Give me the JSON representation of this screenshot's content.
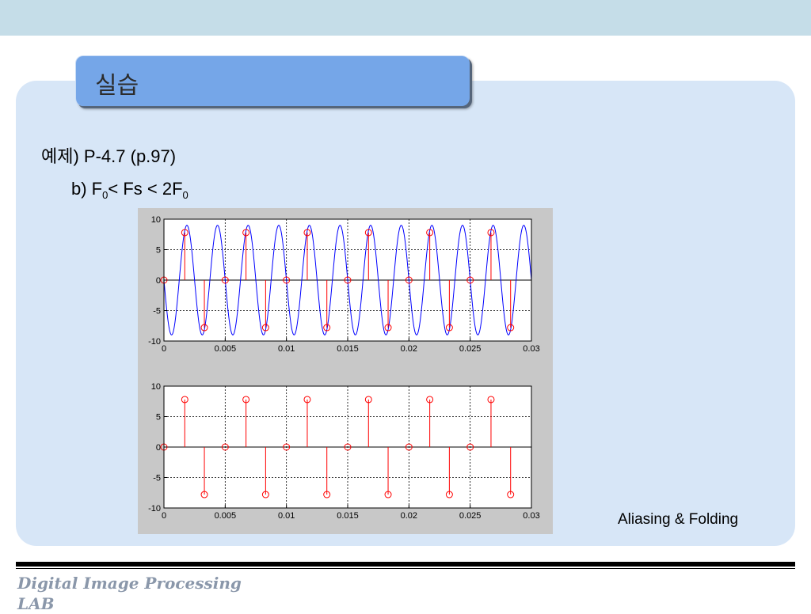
{
  "slide": {
    "title": "실습",
    "line1": "예제) P-4.7 (p.97)",
    "line2": {
      "prefix": "b) F",
      "sub1": "0",
      "mid": "< Fs < 2F",
      "sub2": "0"
    },
    "caption": "Aliasing & Folding",
    "footer": [
      "Digital Image Processing",
      "LAB"
    ]
  },
  "colors": {
    "continuous": "#0000ff",
    "samples": "#ff0000",
    "axes_bg": "#ffffff",
    "figure_bg": "#c8c8c8",
    "panel_bg": "#d7e6f7",
    "title_bg": "#75a6e8"
  },
  "chart_data": [
    {
      "type": "line",
      "description_series": [
        "continuous",
        "sampled"
      ],
      "series": [
        {
          "kind": "continuous",
          "amplitude": 9,
          "frequency": 400
        },
        {
          "kind": "stem",
          "x": [
            0,
            0.0017,
            0.0033,
            0.005,
            0.0067,
            0.0083,
            0.01,
            0.0117,
            0.0133,
            0.015,
            0.0167,
            0.0183,
            0.02,
            0.0217,
            0.0233,
            0.025,
            0.0267,
            0.0283
          ],
          "y": [
            0,
            7.8,
            -7.8,
            0,
            7.8,
            -7.8,
            0,
            7.8,
            -7.8,
            0,
            7.8,
            -7.8,
            0,
            7.8,
            -7.8,
            0,
            7.8,
            -7.8
          ]
        }
      ],
      "xlim": [
        0,
        0.03
      ],
      "ylim": [
        -10,
        10
      ],
      "xticks": [
        "0",
        "0.005",
        "0.01",
        "0.015",
        "0.02",
        "0.025",
        "0.03"
      ],
      "yticks": [
        "10",
        "5",
        "0",
        "-5",
        "-10"
      ],
      "grid": true
    },
    {
      "type": "line",
      "series": [
        {
          "kind": "stem",
          "x": [
            0,
            0.0017,
            0.0033,
            0.005,
            0.0067,
            0.0083,
            0.01,
            0.0117,
            0.0133,
            0.015,
            0.0167,
            0.0183,
            0.02,
            0.0217,
            0.0233,
            0.025,
            0.0267,
            0.0283
          ],
          "y": [
            0,
            7.8,
            -7.8,
            0,
            7.8,
            -7.8,
            0,
            7.8,
            -7.8,
            0,
            7.8,
            -7.8,
            0,
            7.8,
            -7.8,
            0,
            7.8,
            -7.8
          ]
        }
      ],
      "xlim": [
        0,
        0.03
      ],
      "ylim": [
        -10,
        10
      ],
      "xticks": [
        "0",
        "0.005",
        "0.01",
        "0.015",
        "0.02",
        "0.025",
        "0.03"
      ],
      "yticks": [
        "10",
        "5",
        "0",
        "-5",
        "-10"
      ],
      "grid": true
    }
  ]
}
